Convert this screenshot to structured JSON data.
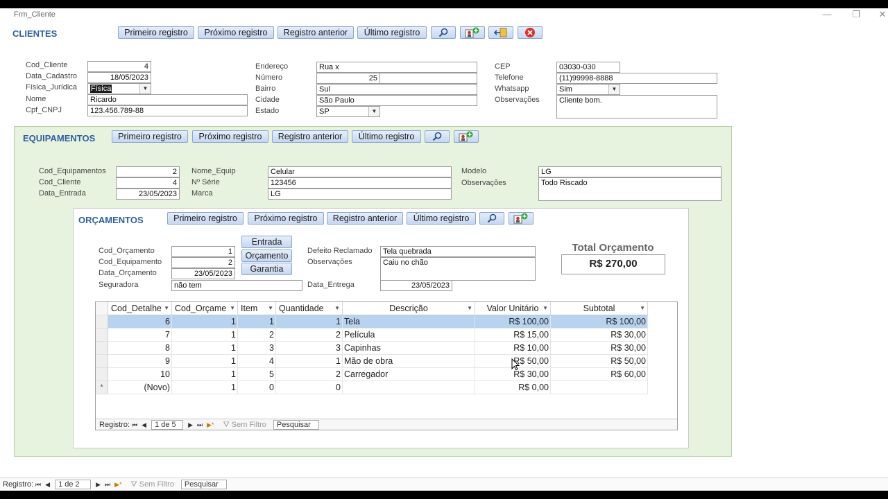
{
  "window": {
    "title": "Frm_Cliente",
    "minimize": "—",
    "restore": "❐",
    "close": "✕"
  },
  "clientes": {
    "heading": "CLIENTES",
    "buttons": {
      "first": "Primeiro registro",
      "next": "Próximo registro",
      "previous": "Registro anterior",
      "last": "Último registro"
    },
    "fields": {
      "cod_cliente": {
        "label": "Cod_Cliente",
        "value": "4"
      },
      "data_cadastro": {
        "label": "Data_Cadastro",
        "value": "18/05/2023"
      },
      "fisica_juridica": {
        "label": "Física_Jurídica",
        "value": "Física"
      },
      "nome": {
        "label": "Nome",
        "value": "Ricardo"
      },
      "cpf_cnpj": {
        "label": "Cpf_CNPJ",
        "value": "123.456.789-88"
      },
      "endereco": {
        "label": "Endereço",
        "value": "Rua x"
      },
      "numero": {
        "label": "Número",
        "value": "25"
      },
      "bairro": {
        "label": "Bairro",
        "value": "Sul"
      },
      "cidade": {
        "label": "Cidade",
        "value": "São Paulo"
      },
      "estado": {
        "label": "Estado",
        "value": "SP"
      },
      "cep": {
        "label": "CEP",
        "value": "03030-030"
      },
      "telefone": {
        "label": "Telefone",
        "value": "(11)99998-8888"
      },
      "whatsapp": {
        "label": "Whatsapp",
        "value": "Sim"
      },
      "observacoes": {
        "label": "Observações",
        "value": "Cliente bom."
      }
    }
  },
  "equipamentos": {
    "heading": "EQUIPAMENTOS",
    "buttons": {
      "first": "Primeiro registro",
      "next": "Próximo registro",
      "previous": "Registro anterior",
      "last": "Último registro"
    },
    "fields": {
      "cod_equipamentos": {
        "label": "Cod_Equipamentos",
        "value": "2"
      },
      "cod_cliente": {
        "label": "Cod_Cliente",
        "value": "4"
      },
      "data_entrada": {
        "label": "Data_Entrada",
        "value": "23/05/2023"
      },
      "nome_equip": {
        "label": "Nome_Equip",
        "value": "Celular"
      },
      "n_serie": {
        "label": "Nº Série",
        "value": "123456"
      },
      "marca": {
        "label": "Marca",
        "value": "LG"
      },
      "modelo": {
        "label": "Modelo",
        "value": "LG"
      },
      "observacoes": {
        "label": "Observações",
        "value": "Todo Riscado"
      }
    }
  },
  "orcamentos": {
    "heading": "ORÇAMENTOS",
    "buttons": {
      "first": "Primeiro registro",
      "next": "Próximo registro",
      "previous": "Registro anterior",
      "last": "Último registro"
    },
    "actions": {
      "entrada": "Entrada",
      "orcamento": "Orçamento",
      "garantia": "Garantia"
    },
    "fields": {
      "cod_orcamento": {
        "label": "Cod_Orçamento",
        "value": "1"
      },
      "cod_equipamento": {
        "label": "Cod_Equipamento",
        "value": "2"
      },
      "data_orcamento": {
        "label": "Data_Orçamento",
        "value": "23/05/2023"
      },
      "seguradora": {
        "label": "Seguradora",
        "value": "não tem"
      },
      "defeito_reclamado": {
        "label": "Defeito Reclamado",
        "value": "Tela quebrada"
      },
      "observacoes": {
        "label": "Observações",
        "value": "Caiu no chão"
      },
      "data_entrega": {
        "label": "Data_Entrega",
        "value": "23/05/2023"
      }
    },
    "total": {
      "label": "Total Orçamento",
      "value": "R$ 270,00"
    },
    "grid": {
      "columns": [
        "Cod_Detalhe",
        "Cod_Orçame",
        "Item",
        "Quantidade",
        "Descrição",
        "Valor Unitário",
        "Subtotal"
      ],
      "rows": [
        [
          "6",
          "1",
          "1",
          "1",
          "Tela",
          "R$ 100,00",
          "R$ 100,00"
        ],
        [
          "7",
          "1",
          "2",
          "2",
          "Película",
          "R$ 15,00",
          "R$ 30,00"
        ],
        [
          "8",
          "1",
          "3",
          "3",
          "Capinhas",
          "R$ 10,00",
          "R$ 30,00"
        ],
        [
          "9",
          "1",
          "4",
          "1",
          "Mão de obra",
          "R$ 50,00",
          "R$ 50,00"
        ],
        [
          "10",
          "1",
          "5",
          "2",
          "Carregador",
          "R$ 30,00",
          "R$ 60,00"
        ]
      ],
      "new_row": [
        "(Novo)",
        "1",
        "0",
        "0",
        "",
        "R$ 0,00",
        ""
      ],
      "new_row_marker": "*"
    },
    "nav": {
      "label": "Registro:",
      "position": "1 de 5",
      "filter": "Sem Filtro",
      "search": "Pesquisar"
    }
  },
  "main_nav": {
    "label": "Registro:",
    "position": "1 de 2",
    "filter": "Sem Filtro",
    "search": "Pesquisar"
  },
  "colors": {
    "heading": "#2e5f9e",
    "panel": "#e7f3df",
    "selected_row": "#b8d3f0",
    "close_icon": "#d9342b"
  },
  "icons": [
    "search-icon",
    "add-user-icon",
    "exit-icon",
    "close-circle-icon"
  ]
}
